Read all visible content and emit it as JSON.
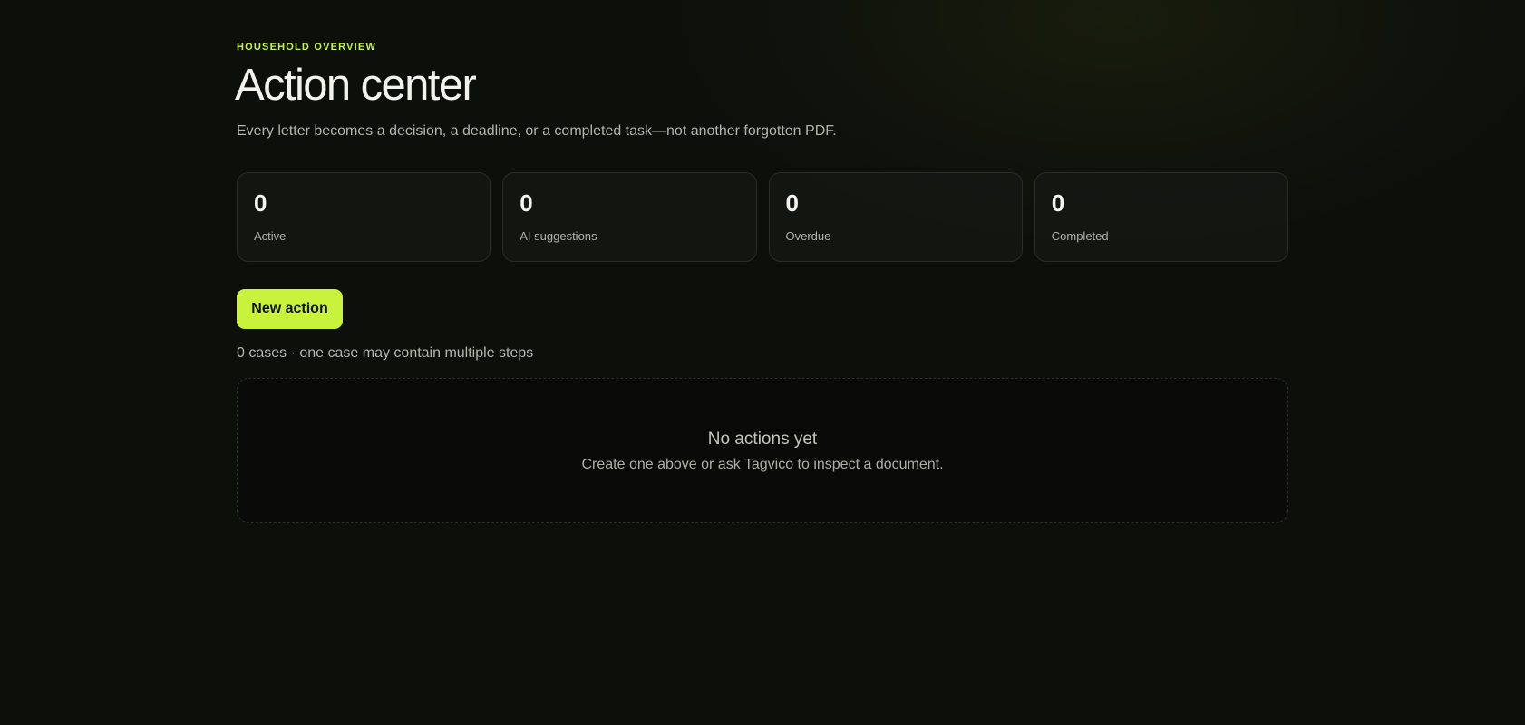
{
  "header": {
    "eyebrow": "HOUSEHOLD OVERVIEW",
    "title": "Action center",
    "subtitle": "Every letter becomes a decision, a deadline, or a completed task—not another forgotten PDF."
  },
  "stats": [
    {
      "value": "0",
      "label": "Active"
    },
    {
      "value": "0",
      "label": "AI suggestions"
    },
    {
      "value": "0",
      "label": "Overdue"
    },
    {
      "value": "0",
      "label": "Completed"
    }
  ],
  "actions": {
    "new_action_label": "New action"
  },
  "cases": {
    "summary": "0 cases · one case may contain multiple steps"
  },
  "empty_state": {
    "title": "No actions yet",
    "description": "Create one above or ask Tagvico to inspect a document."
  },
  "colors": {
    "accent": "#c8f23b",
    "background": "#0d0f0b"
  }
}
